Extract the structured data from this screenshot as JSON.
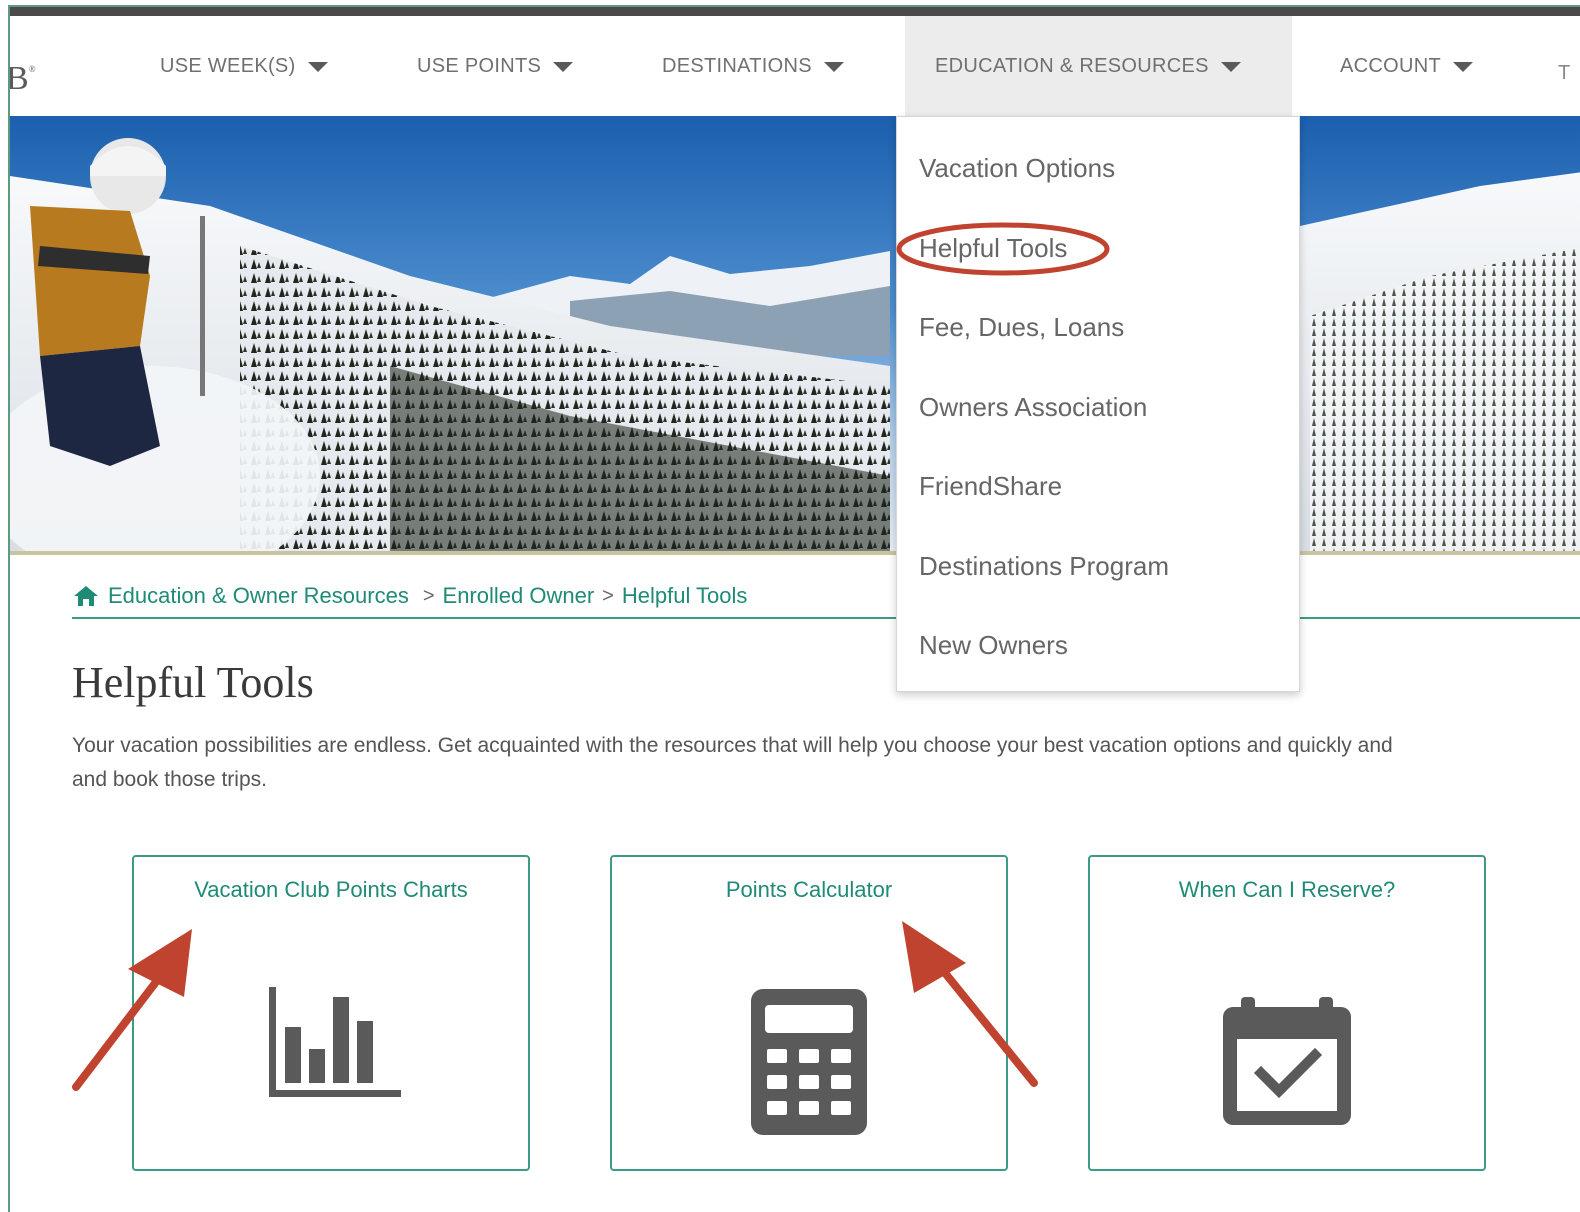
{
  "nav": {
    "logo_fragment": "B",
    "logo_mark": "®",
    "items": [
      {
        "label": "USE WEEK(S)"
      },
      {
        "label": "USE POINTS"
      },
      {
        "label": "DESTINATIONS"
      },
      {
        "label": "EDUCATION & RESOURCES"
      },
      {
        "label": "ACCOUNT"
      }
    ],
    "edge_fragment": "T"
  },
  "dropdown": {
    "items": [
      {
        "label": "Vacation Options"
      },
      {
        "label": "Helpful Tools"
      },
      {
        "label": "Fee, Dues, Loans"
      },
      {
        "label": "Owners Association"
      },
      {
        "label": "FriendShare"
      },
      {
        "label": "Destinations Program"
      },
      {
        "label": "New Owners"
      }
    ]
  },
  "breadcrumb": {
    "items": [
      {
        "label": "Education & Owner Resources"
      },
      {
        "label": "Enrolled Owner"
      },
      {
        "label": "Helpful Tools"
      }
    ],
    "separator": ">"
  },
  "page": {
    "title": "Helpful Tools",
    "intro_line1": "Your vacation possibilities are endless. Get acquainted with the resources that will help you choose your best vacation options and quickly and",
    "intro_line2": "and book those trips."
  },
  "cards": [
    {
      "title": "Vacation Club Points Charts",
      "icon": "bar-chart-icon"
    },
    {
      "title": "Points Calculator",
      "icon": "calculator-icon"
    },
    {
      "title": "When Can I Reserve?",
      "icon": "calendar-check-icon"
    }
  ],
  "colors": {
    "accent": "#1f8a76",
    "annotation": "#c0432f",
    "icon_gray": "#5a5a5a"
  }
}
